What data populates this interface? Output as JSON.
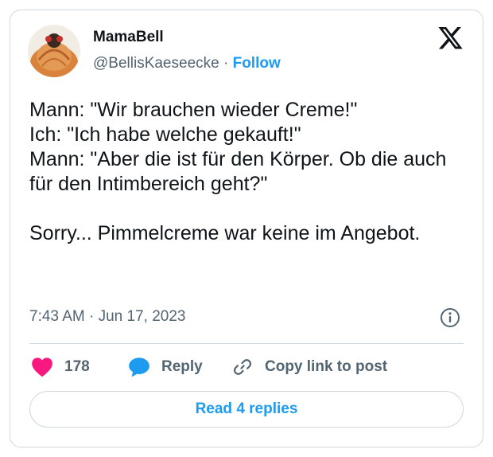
{
  "author": {
    "display_name": "MamaBell",
    "handle": "@BellisKaeseecke",
    "separator": "·",
    "follow_label": "Follow"
  },
  "tweet": {
    "text": "Mann: \"Wir brauchen wieder Creme!\"\nIch: \"Ich habe welche gekauft!\"\nMann: \"Aber die ist für den Körper. Ob die auch für den Intimbereich geht?\"\n\nSorry... Pimmelcreme war keine im Angebot.",
    "timestamp": "7:43 AM · Jun 17, 2023"
  },
  "actions": {
    "like_count": "178",
    "reply_label": "Reply",
    "copy_link_label": "Copy link to post"
  },
  "read_replies_label": "Read 4 replies",
  "icons": {
    "logo": "x-logo-icon",
    "info": "info-icon",
    "like": "heart-icon",
    "reply": "reply-bubble-icon",
    "copy": "link-icon"
  },
  "colors": {
    "accent": "#1d9bf0",
    "like": "#f91880",
    "text": "#0f1419",
    "muted": "#536471",
    "border": "#cfd9de"
  }
}
